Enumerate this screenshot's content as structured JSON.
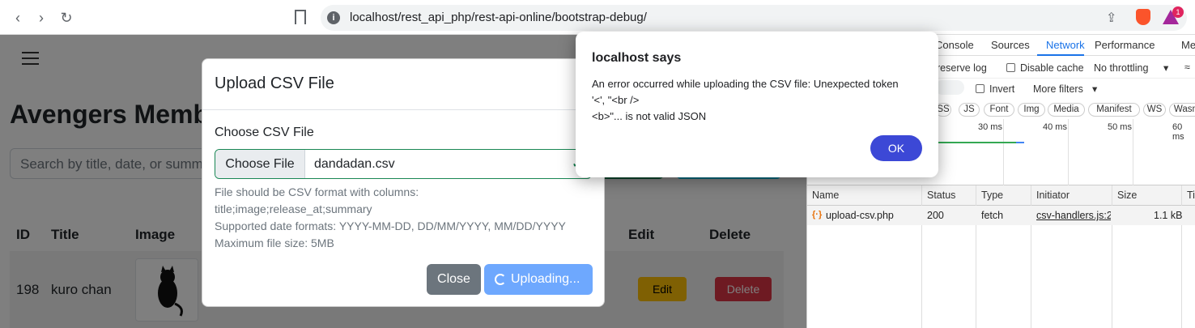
{
  "browser": {
    "url": "localhost/rest_api_php/rest-api-online/bootstrap-debug/",
    "rewards_badge": "1"
  },
  "page": {
    "title": "Avengers Member",
    "search_placeholder": "Search by title, date, or summa",
    "table_headers": [
      "ID",
      "Title",
      "Image",
      "Edit",
      "Delete"
    ],
    "row": {
      "id": "198",
      "title": "kuro chan",
      "edit": "Edit",
      "delete": "Delete"
    }
  },
  "modal": {
    "title": "Upload CSV File",
    "label": "Choose CSV File",
    "file_button": "Choose File",
    "file_name": "dandadan.csv",
    "help_lines": [
      "File should be CSV format with columns:",
      "title;image;release_at;summary",
      "Supported date formats: YYYY-MM-DD, DD/MM/YYYY, MM/DD/YYYY",
      "Maximum file size: 5MB"
    ],
    "close_label": "Close",
    "upload_label": "Uploading..."
  },
  "alert": {
    "title": "localhost says",
    "message": "An error occurred while uploading the CSV file: Unexpected token\n'<', \"<br />\n<b>\"... is not valid JSON",
    "ok_label": "OK"
  },
  "devtools": {
    "tabs": [
      "Console",
      "Sources",
      "Network",
      "Performance",
      "Me"
    ],
    "active_tab": "Network",
    "preserve_log": "reserve log",
    "disable_cache": "Disable cache",
    "throttling": "No throttling",
    "invert": "Invert",
    "more_filters": "More filters",
    "filter_chips": [
      "SS",
      "JS",
      "Font",
      "Img",
      "Media",
      "Manifest",
      "WS",
      "Wasm"
    ],
    "timeline_labels": [
      "30 ms",
      "40 ms",
      "50 ms",
      "60 ms"
    ],
    "columns": [
      "Name",
      "Status",
      "Type",
      "Initiator",
      "Size",
      "Ti"
    ],
    "request": {
      "name": "upload-csv.php",
      "status": "200",
      "type": "fetch",
      "initiator": "csv-handlers.js:2",
      "size": "1.1 kB"
    }
  }
}
